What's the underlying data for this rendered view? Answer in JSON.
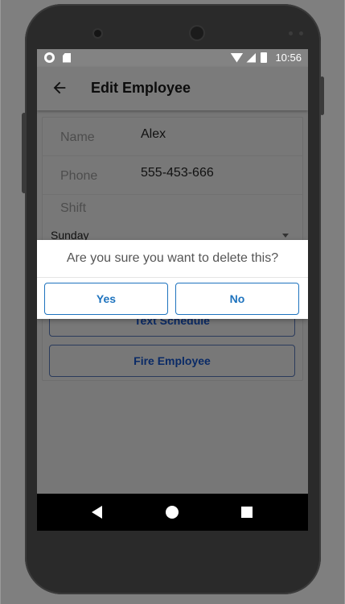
{
  "status_bar": {
    "time": "10:56",
    "icons": [
      "circle-icon",
      "sd-card-icon",
      "wifi-icon",
      "signal-icon",
      "battery-icon"
    ]
  },
  "app_bar": {
    "title": "Edit Employee",
    "back_icon": "arrow-back-icon"
  },
  "form": {
    "name_label": "Name",
    "name_value": "Alex",
    "phone_label": "Phone",
    "phone_value": "555-453-666",
    "shift_label": "Shift",
    "shift_value": "Sunday",
    "text_schedule_label": "Text Schedule",
    "fire_employee_label": "Fire Employee"
  },
  "dialog": {
    "message": "Are you sure you want to delete this?",
    "yes_label": "Yes",
    "no_label": "No"
  },
  "nav_bar": {
    "icons": [
      "nav-back-icon",
      "nav-home-icon",
      "nav-recent-icon"
    ]
  },
  "colors": {
    "accent": "#1e73be",
    "dim_overlay": "#777777",
    "nav_bar": "#000000"
  }
}
